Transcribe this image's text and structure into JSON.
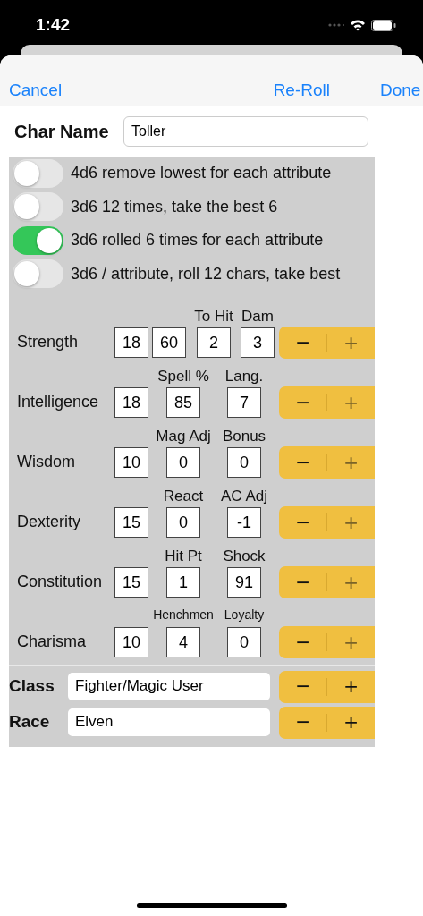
{
  "status_bar": {
    "time": "1:42"
  },
  "nav": {
    "cancel": "Cancel",
    "reroll": "Re-Roll",
    "done": "Done"
  },
  "char_name": {
    "label": "Char Name",
    "value": "Toller"
  },
  "methods": [
    {
      "label": "4d6 remove lowest for each attribute",
      "on": false
    },
    {
      "label": "3d6 12 times, take the best 6",
      "on": false
    },
    {
      "label": "3d6 rolled 6 times for each attribute",
      "on": true
    },
    {
      "label": "3d6 / attribute, roll 12 chars, take best",
      "on": false
    }
  ],
  "attributes": [
    {
      "name": "Strength",
      "kind": "four",
      "small_headers": false,
      "plus_disabled": true,
      "boxes": [
        {
          "value": "18"
        },
        {
          "value": "60"
        },
        {
          "value": "2",
          "header": "To Hit"
        },
        {
          "value": "3",
          "header": "Dam"
        }
      ]
    },
    {
      "name": "Intelligence",
      "kind": "three",
      "small_headers": false,
      "plus_disabled": true,
      "boxes": [
        {
          "value": "18"
        },
        {
          "value": "85",
          "header": "Spell %"
        },
        {
          "value": "7",
          "header": "Lang."
        }
      ]
    },
    {
      "name": "Wisdom",
      "kind": "three",
      "small_headers": false,
      "plus_disabled": true,
      "boxes": [
        {
          "value": "10"
        },
        {
          "value": "0",
          "header": "Mag Adj"
        },
        {
          "value": "0",
          "header": "Bonus"
        }
      ]
    },
    {
      "name": "Dexterity",
      "kind": "three",
      "small_headers": false,
      "plus_disabled": true,
      "boxes": [
        {
          "value": "15"
        },
        {
          "value": "0",
          "header": "React"
        },
        {
          "value": "-1",
          "header": "AC Adj"
        }
      ]
    },
    {
      "name": "Constitution",
      "kind": "three",
      "small_headers": false,
      "plus_disabled": true,
      "boxes": [
        {
          "value": "15"
        },
        {
          "value": "1",
          "header": "Hit Pt"
        },
        {
          "value": "91",
          "header": "Shock"
        }
      ]
    },
    {
      "name": "Charisma",
      "kind": "three",
      "small_headers": true,
      "plus_disabled": true,
      "boxes": [
        {
          "value": "10"
        },
        {
          "value": "4",
          "header": "Henchmen"
        },
        {
          "value": "0",
          "header": "Loyalty"
        }
      ]
    }
  ],
  "pickers": [
    {
      "label": "Class",
      "value": "Fighter/Magic User",
      "minus": "−",
      "plus": "+",
      "plus_disabled": false
    },
    {
      "label": "Race",
      "value": "Elven",
      "minus": "−",
      "plus": "+",
      "plus_disabled": false
    }
  ],
  "stepper_glyphs": {
    "minus": "−",
    "plus": "+"
  }
}
